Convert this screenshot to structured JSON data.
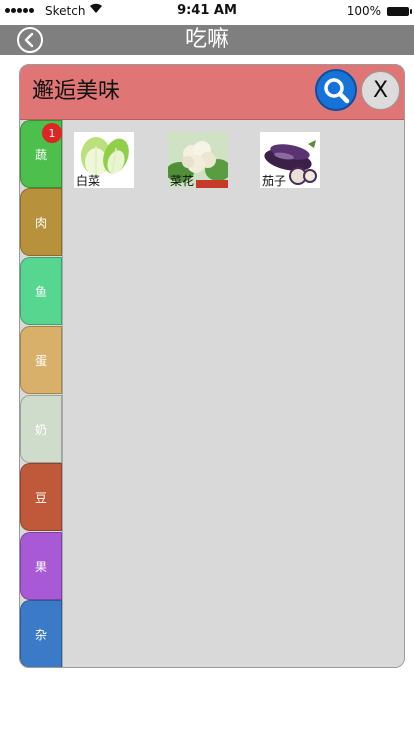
{
  "status_bar": {
    "carrier": "Sketch",
    "time": "9:41 AM",
    "battery": "100%"
  },
  "navbar": {
    "title": "吃嘛",
    "back_icon": "back-arrow-circle-icon"
  },
  "panel": {
    "title": "邂逅美味",
    "search_icon": "magnifier-icon",
    "close_label": "X",
    "header_color": "#e07575"
  },
  "categories": [
    {
      "label": "蔬",
      "color": "#4cbf4c",
      "badge": "1"
    },
    {
      "label": "肉",
      "color": "#b8913c"
    },
    {
      "label": "鱼",
      "color": "#57d68f"
    },
    {
      "label": "蛋",
      "color": "#d8b06a"
    },
    {
      "label": "奶",
      "color": "#cfdccb"
    },
    {
      "label": "豆",
      "color": "#c0593a"
    },
    {
      "label": "果",
      "color": "#a85ad6"
    },
    {
      "label": "杂",
      "color": "#3a7ac6"
    }
  ],
  "items": [
    {
      "label": "白菜",
      "image": "cabbage"
    },
    {
      "label": "菜花",
      "image": "cauliflower"
    },
    {
      "label": "茄子",
      "image": "eggplant"
    }
  ]
}
